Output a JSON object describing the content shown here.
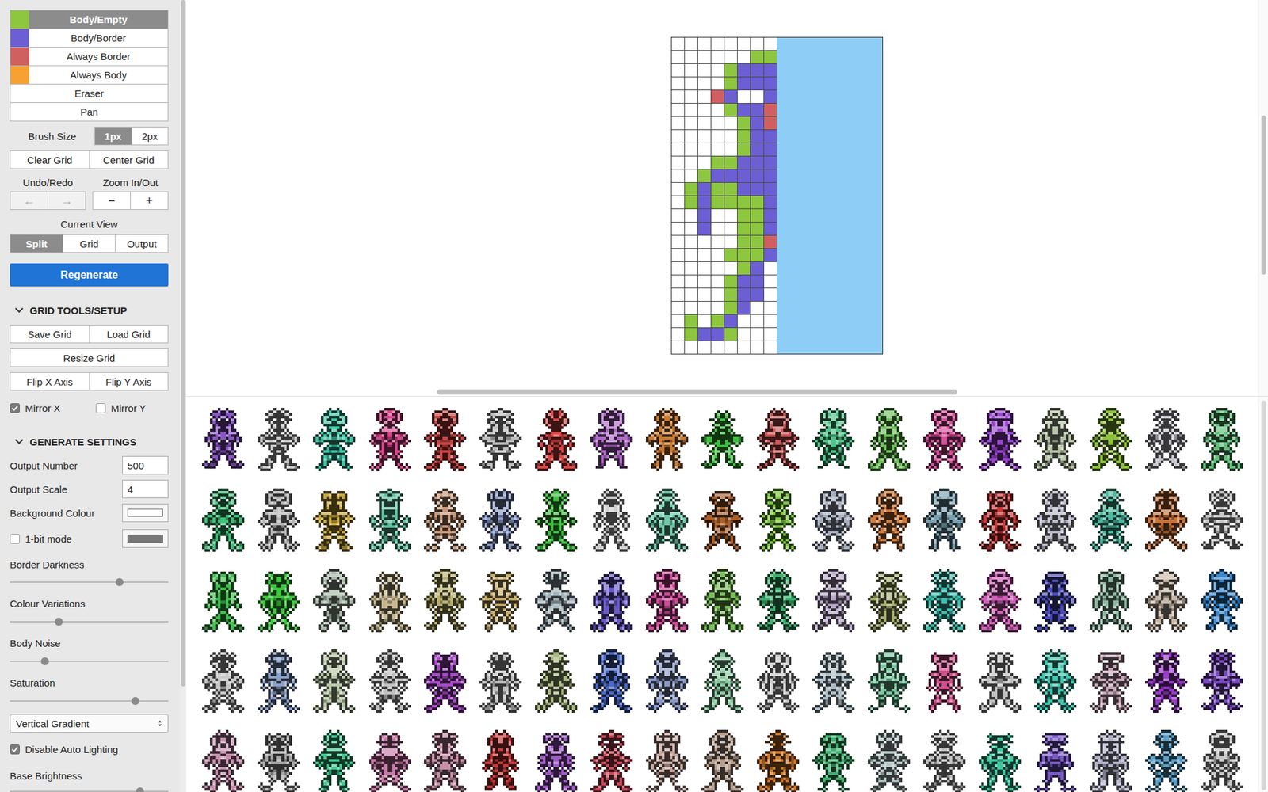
{
  "tools": [
    {
      "label": "Body/Empty",
      "kind": "paint",
      "color": "#8dc63f",
      "selected": true
    },
    {
      "label": "Body/Border",
      "kind": "paint",
      "color": "#6b5fd3",
      "selected": false
    },
    {
      "label": "Always Border",
      "kind": "paint",
      "color": "#d0605f",
      "selected": false
    },
    {
      "label": "Always Body",
      "kind": "paint",
      "color": "#f7a132",
      "selected": false
    },
    {
      "label": "Eraser",
      "kind": "plain",
      "selected": false
    },
    {
      "label": "Pan",
      "kind": "plain",
      "selected": false
    }
  ],
  "brush": {
    "label": "Brush Size",
    "options": [
      {
        "label": "1px",
        "selected": true
      },
      {
        "label": "2px",
        "selected": false
      }
    ]
  },
  "grid_buttons": [
    "Clear Grid",
    "Center Grid"
  ],
  "undo": {
    "label": "Undo/Redo",
    "buttons": [
      {
        "label": "←",
        "disabled": true
      },
      {
        "label": "→",
        "disabled": true
      }
    ]
  },
  "zoom": {
    "label": "Zoom In/Out",
    "buttons": [
      {
        "label": "−",
        "disabled": false
      },
      {
        "label": "+",
        "disabled": false
      }
    ]
  },
  "view": {
    "label": "Current View",
    "options": [
      {
        "label": "Split",
        "selected": true
      },
      {
        "label": "Grid",
        "selected": false
      },
      {
        "label": "Output",
        "selected": false
      }
    ]
  },
  "regenerate": "Regenerate",
  "grid_tools": {
    "title": "GRID TOOLS/SETUP",
    "expanded": true,
    "button_rows": [
      [
        "Save Grid",
        "Load Grid"
      ],
      [
        "Resize Grid"
      ],
      [
        "Flip X Axis",
        "Flip Y Axis"
      ]
    ],
    "checkboxes": [
      {
        "label": "Mirror X",
        "checked": true
      },
      {
        "label": "Mirror Y",
        "checked": false
      }
    ]
  },
  "generate": {
    "title": "GENERATE SETTINGS",
    "expanded": true,
    "fields": [
      {
        "label": "Output Number",
        "value": "500"
      },
      {
        "label": "Output Scale",
        "value": "4"
      }
    ],
    "background": {
      "label": "Background Colour",
      "color": "#ffffff"
    },
    "one_bit": {
      "label": "1-bit mode",
      "checked": false,
      "color": "#777777"
    },
    "sliders": [
      {
        "label": "Border Darkness",
        "level": 0.69
      },
      {
        "label": "Colour Variations",
        "level": 0.31
      },
      {
        "label": "Body Noise",
        "level": 0.22
      },
      {
        "label": "Saturation",
        "level": 0.79
      }
    ],
    "lighting_mode": "Vertical Gradient",
    "auto_lighting": {
      "label": "Disable Auto Lighting",
      "checked": true
    },
    "base_brightness": {
      "label": "Base Brightness",
      "level": 0.82
    }
  },
  "editor": {
    "rows": [
      "........",
      "......00",
      "....0111",
      "....0111",
      "...21..1",
      "....0112",
      ".....012",
      ".....011",
      ".....011",
      "...00111",
      "..011111",
      ".0100111",
      ".0100001",
      "..1..001",
      "..1..001",
      ".....002",
      "....0001",
      ".....01.",
      "....011.",
      "....011.",
      "....01..",
      ".0.01...",
      ".0110...",
      "........"
    ]
  },
  "output": {
    "sprites": [
      {
        "color": "#8b55c8"
      },
      {
        "color": "#c9c9c9"
      },
      {
        "color": "#3cc4a5"
      },
      {
        "color": "#d5478c"
      },
      {
        "color": "#c94545"
      },
      {
        "color": "#bdbdbd"
      },
      {
        "color": "#d94848"
      },
      {
        "color": "#b06ac8"
      },
      {
        "color": "#c87a30"
      },
      {
        "color": "#3fbf3f"
      },
      {
        "color": "#c85a5a"
      },
      {
        "color": "#4fc48a"
      },
      {
        "color": "#6fc05a"
      },
      {
        "color": "#d5509a"
      },
      {
        "color": "#9a45d0"
      },
      {
        "color": "#b8c4a8"
      },
      {
        "color": "#8ec23a"
      },
      {
        "color": "#c9c9d2"
      },
      {
        "color": "#5fbf7a"
      },
      {
        "color": "#3fbf7a"
      },
      {
        "color": "#b5b5b5"
      },
      {
        "color": "#c8a83a"
      },
      {
        "color": "#5fc0a0"
      },
      {
        "color": "#c89a7a"
      },
      {
        "color": "#8a9ac8"
      },
      {
        "color": "#3fbf3f"
      },
      {
        "color": "#d0d0d0"
      },
      {
        "color": "#6fc8a8"
      },
      {
        "color": "#a8602a"
      },
      {
        "color": "#7ac83a"
      },
      {
        "color": "#a8b0c0"
      },
      {
        "color": "#d07a3a"
      },
      {
        "color": "#7aa0b0"
      },
      {
        "color": "#c83a3a"
      },
      {
        "color": "#b8b8c8"
      },
      {
        "color": "#4fb8a0"
      },
      {
        "color": "#c8743a"
      },
      {
        "color": "#c8c8c8"
      },
      {
        "color": "#3fc04f"
      },
      {
        "color": "#3fc83f"
      },
      {
        "color": "#a8b8a8"
      },
      {
        "color": "#c8b890"
      },
      {
        "color": "#b8b070"
      },
      {
        "color": "#c8b070"
      },
      {
        "color": "#a0b0b8"
      },
      {
        "color": "#6a5ac8"
      },
      {
        "color": "#d04a9a"
      },
      {
        "color": "#7ac05a"
      },
      {
        "color": "#3fb070"
      },
      {
        "color": "#b8a8c8"
      },
      {
        "color": "#a8b070"
      },
      {
        "color": "#3fc0b0"
      },
      {
        "color": "#d060b8"
      },
      {
        "color": "#4a4ab8"
      },
      {
        "color": "#8ab8a0"
      },
      {
        "color": "#c8b8a8"
      },
      {
        "color": "#3a8ad0"
      },
      {
        "color": "#c8c8c8"
      },
      {
        "color": "#8aa0c8"
      },
      {
        "color": "#b8c8a8"
      },
      {
        "color": "#c0c0c0"
      },
      {
        "color": "#a84ac8"
      },
      {
        "color": "#c0c0c0"
      },
      {
        "color": "#a8b880"
      },
      {
        "color": "#4a6ac8"
      },
      {
        "color": "#8a9ac8"
      },
      {
        "color": "#8ac8a0"
      },
      {
        "color": "#c8c8c8"
      },
      {
        "color": "#b0c0c8"
      },
      {
        "color": "#7ac8a0"
      },
      {
        "color": "#d0508a"
      },
      {
        "color": "#c0c0c0"
      },
      {
        "color": "#3fc8b0"
      },
      {
        "color": "#c8a8b8"
      },
      {
        "color": "#9a3ac8"
      },
      {
        "color": "#7a4ac0"
      },
      {
        "color": "#c890b0"
      },
      {
        "color": "#a8a8a8"
      },
      {
        "color": "#3fc890"
      },
      {
        "color": "#c87aa8"
      },
      {
        "color": "#c890a8"
      },
      {
        "color": "#c83a3a"
      },
      {
        "color": "#a05ac8"
      },
      {
        "color": "#c84a5a"
      },
      {
        "color": "#c8a8a0"
      },
      {
        "color": "#b8a090"
      },
      {
        "color": "#d07a2a"
      },
      {
        "color": "#3fb070"
      },
      {
        "color": "#b8c8c8"
      },
      {
        "color": "#c0c0c0"
      },
      {
        "color": "#3fc8a0"
      },
      {
        "color": "#7a5ac8"
      },
      {
        "color": "#b0b0c8"
      },
      {
        "color": "#5aa0c8"
      },
      {
        "color": "#c8c8c8"
      }
    ]
  }
}
